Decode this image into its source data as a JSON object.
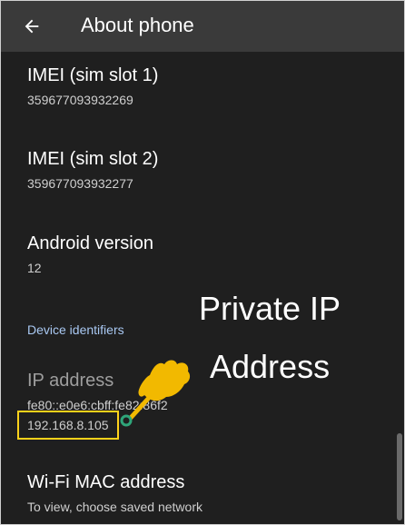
{
  "appbar": {
    "title": "About phone"
  },
  "items": {
    "imei1": {
      "title": "IMEI (sim slot 1)",
      "value": "359677093932269"
    },
    "imei2": {
      "title": "IMEI (sim slot 2)",
      "value": "359677093932277"
    },
    "android": {
      "title": "Android version",
      "value": "12"
    },
    "section": "Device identifiers",
    "ip": {
      "title": "IP address",
      "ipv6": "fe80::e0e6:cbff:fe82:86f2",
      "ipv4": "192.168.8.105"
    },
    "wifi_mac": {
      "title": "Wi-Fi MAC address",
      "summary": "To view, choose saved network"
    }
  },
  "annotation": {
    "line1": "Private IP",
    "line2": "Address"
  },
  "colors": {
    "background": "#1f1f1f",
    "appbar": "#3a3a3a",
    "section_header": "#a9c8f2",
    "highlight_box": "#ffd21a",
    "pointer_hand": "#f2b900"
  },
  "icons": {
    "back": "arrow-back-icon",
    "pointer": "pointing-hand-icon"
  }
}
